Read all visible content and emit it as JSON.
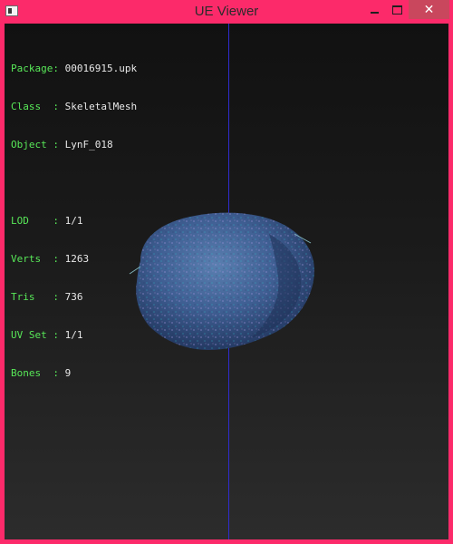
{
  "window": {
    "title": "UE Viewer",
    "icon": "app-icon",
    "buttons": {
      "minimize": "minimize-icon",
      "maximize": "maximize-icon",
      "close": "close-icon",
      "close_glyph": "✕"
    },
    "frame_color": "#fc2a6a"
  },
  "info": {
    "package": {
      "label": "Package:",
      "value": "00016915.upk"
    },
    "class": {
      "label": "Class  :",
      "value": "SkeletalMesh"
    },
    "object": {
      "label": "Object :",
      "value": "LynF_018"
    },
    "lod": {
      "label": "LOD    :",
      "value": "1/1"
    },
    "verts": {
      "label": "Verts  :",
      "value": "1263"
    },
    "tris": {
      "label": "Tris   :",
      "value": "736"
    },
    "uvset": {
      "label": "UV Set :",
      "value": "1/1"
    },
    "bones": {
      "label": "Bones  :",
      "value": "9"
    }
  },
  "colors": {
    "label": "#58e858",
    "value": "#e8e8e8",
    "axis": "#2f2ccf",
    "mesh": "#3d5a8a"
  }
}
